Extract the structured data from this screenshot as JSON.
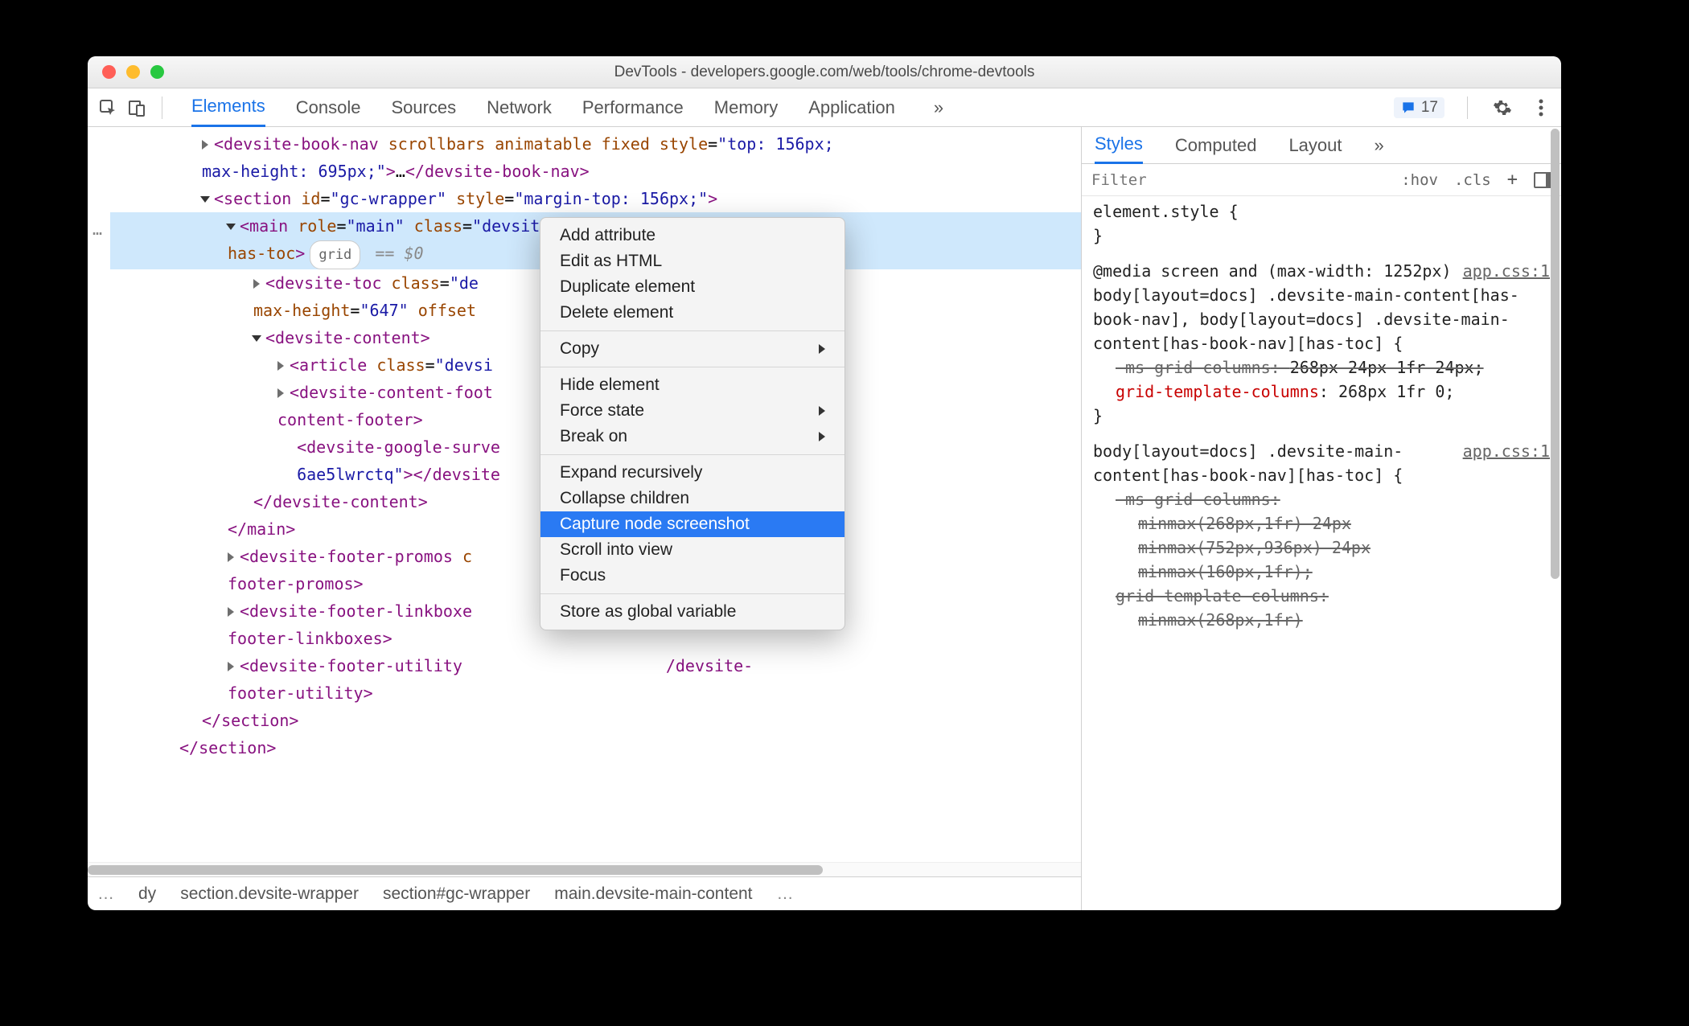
{
  "window": {
    "title": "DevTools - developers.google.com/web/tools/chrome-devtools"
  },
  "toolbar": {
    "tabs": [
      "Elements",
      "Console",
      "Sources",
      "Network",
      "Performance",
      "Memory",
      "Application"
    ],
    "active_tab": "Elements",
    "overflow": "»",
    "message_count": "17"
  },
  "dom_gutter_more": "…",
  "dom_lines": {
    "l0a": "<devsite-book-nav scrollbars animatable fixed style=\"top: 156px; ",
    "l0b": "max-height: 695px;\">…</devsite-book-nav>",
    "l1": "<section id=\"gc-wrapper\" style=\"margin-top: 156px;\">",
    "l2a": "<main role=\"main\" class=\"devsite-main-content\" has-book-nav ",
    "l2b_pre": "has-toc>",
    "l2b_pill": "grid",
    "l2b_post": " == $0",
    "l3a": "<devsite-toc class=\"devsite-toc-embedded\" visible fixed ",
    "l3b": "max-height=\"647\" offset=\"64\">…</devsite-toc>",
    "l4": "<devsite-content>",
    "l5": "<article class=\"devsite-article\">…</article>",
    "l6a": "<devsite-content-footer class=\"nocontent\">…</devsite-",
    "l6b": "content-footer>",
    "l7a": "<devsite-google-survey survey-id=\"egbj5ifxusvvmr4pp",
    "l7b": "6ae5lwrctq\"></devsite-google-survey>",
    "l8": "</devsite-content>",
    "l9": "</main>",
    "l10a": "<devsite-footer-promos class=\"nocontent\">…</devsite-",
    "l10b": "footer-promos>",
    "l11a": "<devsite-footer-linkboxes class=\"nocontent\">…</devsite-",
    "l11b": "footer-linkboxes>",
    "l12a": "<devsite-footer-utility class=\"nocontent\">…</devsite-",
    "l12b": "footer-utility>",
    "l13": "</section>",
    "l14": "</section>"
  },
  "crumbs": {
    "left_ell": "…",
    "c0": "dy",
    "c1": "section.devsite-wrapper",
    "c2": "section#gc-wrapper",
    "c3": "main.devsite-main-content",
    "right_ell": "…"
  },
  "styles_panel": {
    "tabs": [
      "Styles",
      "Computed",
      "Layout"
    ],
    "overflow": "»",
    "active": "Styles",
    "filter_placeholder": "Filter",
    "hov": ":hov",
    "cls": ".cls",
    "plus": "+",
    "rule1": {
      "selector": "element.style {",
      "close": "}"
    },
    "rule2": {
      "media": "@media screen and (max-width: 1252px)",
      "link": "app.css:1",
      "selector": "body[layout=docs] .devsite-main-content[has-book-nav], body[layout=docs] .devsite-main-content[has-book-nav][has-toc] {",
      "decl1_prop": "-ms-grid-columns",
      "decl1_val": "268px 24px 1fr 24px;",
      "decl2_prop": "grid-template-columns",
      "decl2_val": "268px 1fr 0;",
      "close": "}"
    },
    "rule3": {
      "link": "app.css:1",
      "selector": "body[layout=docs] .devsite-main-content[has-book-nav][has-toc] {",
      "decl1_prop": "-ms-grid-columns",
      "decl1_vals": [
        "minmax(268px,1fr) 24px",
        "minmax(752px,936px) 24px",
        "minmax(160px,1fr);"
      ],
      "decl2_prop": "grid-template-columns",
      "decl2_val": "minmax(268px,1fr)"
    }
  },
  "context_menu": {
    "items": [
      {
        "label": "Add attribute"
      },
      {
        "label": "Edit as HTML"
      },
      {
        "label": "Duplicate element"
      },
      {
        "label": "Delete element"
      },
      {
        "sep": true
      },
      {
        "label": "Copy",
        "sub": true
      },
      {
        "sep": true
      },
      {
        "label": "Hide element"
      },
      {
        "label": "Force state",
        "sub": true
      },
      {
        "label": "Break on",
        "sub": true
      },
      {
        "sep": true
      },
      {
        "label": "Expand recursively"
      },
      {
        "label": "Collapse children"
      },
      {
        "label": "Capture node screenshot",
        "selected": true
      },
      {
        "label": "Scroll into view"
      },
      {
        "label": "Focus"
      },
      {
        "sep": true
      },
      {
        "label": "Store as global variable"
      }
    ]
  }
}
